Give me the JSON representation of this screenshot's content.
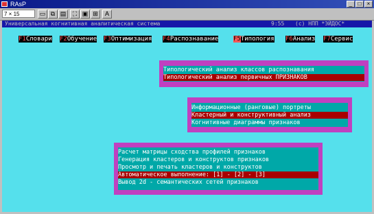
{
  "window": {
    "title": "RAsP",
    "controls": [
      "_",
      "□",
      "×"
    ]
  },
  "toolbar": {
    "font_select": "7 × 15",
    "font_letter": "A"
  },
  "status": {
    "system_name": "Универсальная когнитивная аналитическая система",
    "time": "9:55",
    "copyright": "(c) НПП *ЭЙДОС*"
  },
  "menu": [
    {
      "key": "F1",
      "label": "Словари"
    },
    {
      "key": "F2",
      "label": "Обучение"
    },
    {
      "key": "F3",
      "label": "Оптимизация"
    },
    {
      "key": "F4",
      "label": "Распознавание"
    },
    {
      "key": "F5",
      "label": "Типология"
    },
    {
      "key": "F6",
      "label": "Анализ"
    },
    {
      "key": "F7",
      "label": "Сервис"
    }
  ],
  "submenu1": {
    "items": [
      "Типологический анализ классов распознавания",
      "Типологический анализ первичных ПРИЗНАКОВ"
    ]
  },
  "submenu2": {
    "items": [
      "Информационные (ранговые) портреты",
      "Кластерный и конструктивный анализ",
      "Когнитивные диаграммы признаков"
    ]
  },
  "submenu3": {
    "items": [
      "Расчет матрицы сходства профилей  признаков",
      "Генерация кластеров и конструктов признаков",
      "Просмотр  и  печать кластеров и конструктов",
      "Автоматическое выполнение: [1] - [2] - [3]",
      "Вывод 2d - семантических сетей признаков"
    ]
  },
  "colors": {
    "screen_bg": "#55e0ec",
    "status_bg": "#1717a8",
    "popup_border": "#c040c0",
    "popup_bg": "#00a8a8",
    "highlight": "#a80000",
    "menu_key": "#ff5555"
  }
}
